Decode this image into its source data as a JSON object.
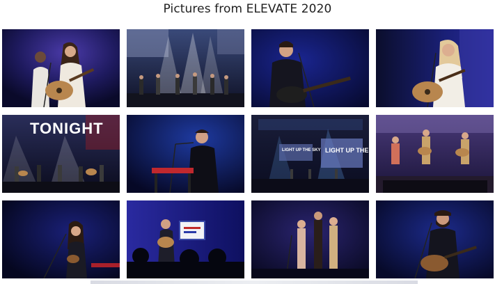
{
  "gallery": {
    "title": "Pictures from ELEVATE 2020"
  },
  "photos": [
    {
      "id": "photo-1",
      "subject": "singer-with-guitar-and-duet-partner"
    },
    {
      "id": "photo-2",
      "subject": "full-band-stage-with-lights"
    },
    {
      "id": "photo-3",
      "subject": "male-guitarist-singing"
    },
    {
      "id": "photo-4",
      "subject": "female-singer-acoustic-guitar"
    },
    {
      "id": "photo-5",
      "subject": "band-under-tonight-sign",
      "screen_text": "TONIGHT"
    },
    {
      "id": "photo-6",
      "subject": "keyboard-player-singing"
    },
    {
      "id": "photo-7",
      "subject": "wide-stage-light-up-the-sky",
      "screen_text_left": "LIGHT UP THE SKY",
      "screen_text_right": "LIGHT UP THE SKY"
    },
    {
      "id": "photo-8",
      "subject": "trio-band-on-lit-stage"
    },
    {
      "id": "photo-9",
      "subject": "female-singer-dark-stage"
    },
    {
      "id": "photo-10",
      "subject": "guitarist-with-sign-and-crowd"
    },
    {
      "id": "photo-11",
      "subject": "vocal-trio-singing"
    },
    {
      "id": "photo-12",
      "subject": "bearded-guitarist-singing"
    }
  ],
  "colors": {
    "stage_dark": "#0b0e2c",
    "stage_blue": "#1f2a8a",
    "stage_purple": "#3a1f7a",
    "spotlight": "#cfd8ff",
    "skin": "#d7a98a",
    "guitar_wood": "#b8864e"
  }
}
